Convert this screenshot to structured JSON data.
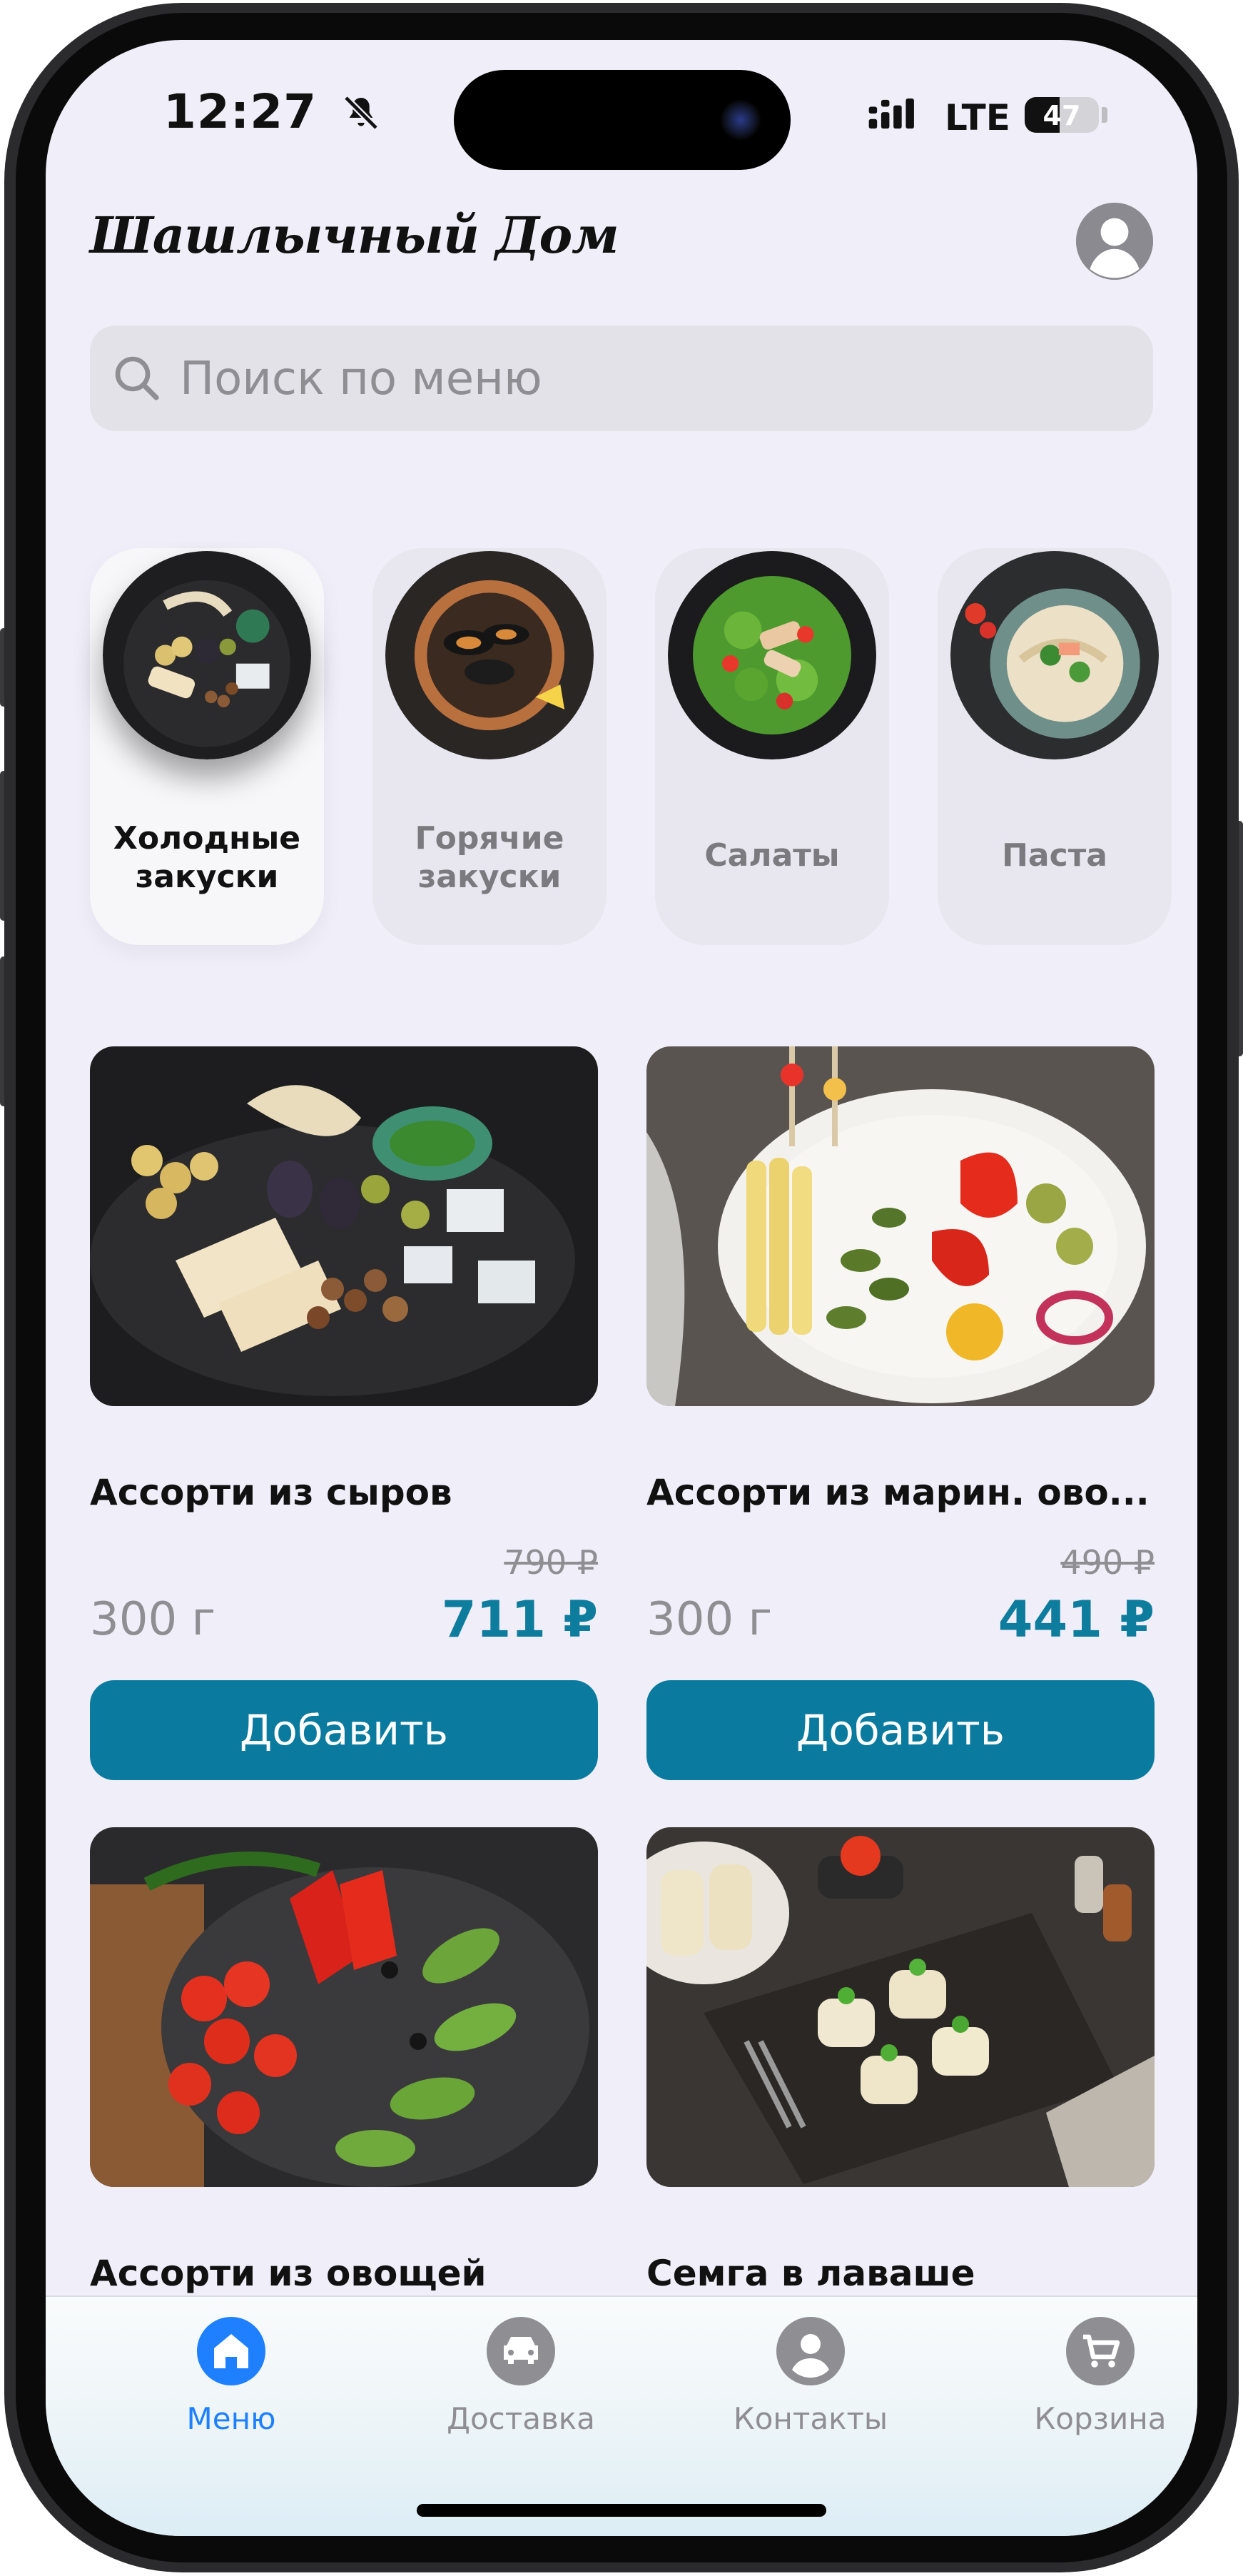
{
  "status_bar": {
    "time": "12:27",
    "network": "LTE",
    "battery": "47",
    "battery_level": 0.47
  },
  "header": {
    "title": "Шашлычный Дом"
  },
  "search": {
    "placeholder": "Поиск по меню"
  },
  "categories": [
    {
      "label": "Холодные\nзакуски",
      "active": true
    },
    {
      "label": "Горячие\nзакуски",
      "active": false
    },
    {
      "label": "Салаты",
      "active": false
    },
    {
      "label": "Паста",
      "active": false
    }
  ],
  "products": [
    {
      "title": "Ассорти из сыров",
      "old_price": "790 ₽",
      "price": "711 ₽",
      "weight": "300 г",
      "button": "Добавить"
    },
    {
      "title": "Ассорти из марин. ово...",
      "old_price": "490 ₽",
      "price": "441 ₽",
      "weight": "300 г",
      "button": "Добавить"
    },
    {
      "title": "Ассорти из овощей"
    },
    {
      "title": "Семга в лаваше"
    }
  ],
  "tabbar": {
    "items": [
      {
        "label": "Меню",
        "icon": "home-icon",
        "active": true
      },
      {
        "label": "Доставка",
        "icon": "car-icon",
        "active": false
      },
      {
        "label": "Контакты",
        "icon": "person-icon",
        "active": false
      },
      {
        "label": "Корзина",
        "icon": "cart-icon",
        "active": false
      }
    ]
  },
  "colors": {
    "accent": "#0a7b9e",
    "price": "#0e7c9d",
    "tab_active": "#1f80ff",
    "background": "#f0eef8"
  }
}
